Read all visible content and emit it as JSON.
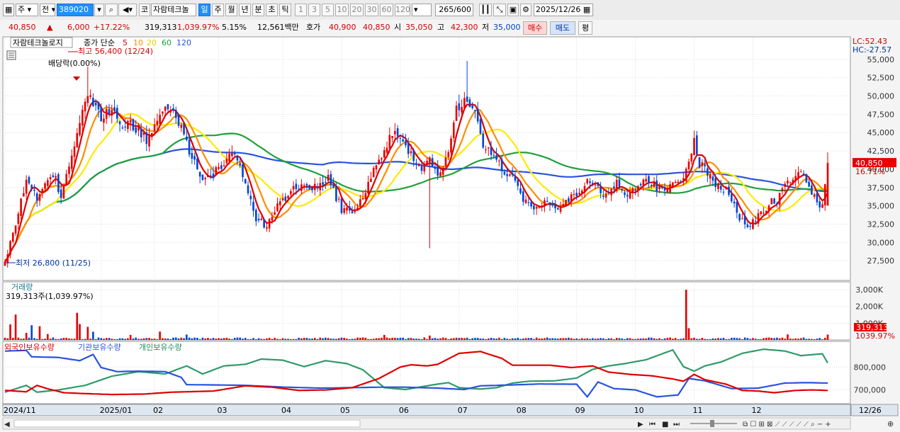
{
  "toolbar": {
    "market": "주",
    "type": "전",
    "code": "389020",
    "stock_type": "코",
    "stock_name": "자람테크놀",
    "periods": [
      "일",
      "주",
      "월",
      "년",
      "분",
      "초",
      "틱"
    ],
    "active_period": "일",
    "ticks": [
      "1",
      "3",
      "5",
      "10",
      "20",
      "30",
      "60",
      "120"
    ],
    "count": "265",
    "count_total": "/600",
    "date": "2025/12/26"
  },
  "quote": {
    "price": "40,850",
    "change": "6,000",
    "change_pct": "+17.22%",
    "volume": "319,313",
    "volume_ratio": "1,039.97%",
    "turnover": "5.15%",
    "amount": "12,561백만",
    "bid_label": "호가",
    "bid": "40,900",
    "ask": "40,850",
    "open_label": "시",
    "open": "35,050",
    "high_label": "고",
    "high": "42,300",
    "low_label": "저",
    "low": "35,000",
    "buy": "매수",
    "sell": "매도",
    "avg": "평"
  },
  "colors": {
    "up": "#e60000",
    "down": "#0046d5",
    "ma5": "#e00000",
    "ma10": "#ff8c00",
    "ma20": "#ffea00",
    "ma60": "#1fa03c",
    "ma120": "#2a52e0"
  },
  "chart_data": [
    {
      "type": "candlestick",
      "legend_stock": "자람테크놀로지",
      "legend_prefix": "종가 단순",
      "ma_periods": [
        "5",
        "10",
        "20",
        "60",
        "120"
      ],
      "y_ticks": [
        "55,000",
        "52,500",
        "50,000",
        "47,500",
        "45,000",
        "42,500",
        "40,000",
        "37,500",
        "35,000",
        "32,500",
        "30,000",
        "27,500"
      ],
      "y_tick_values": [
        55000,
        52500,
        50000,
        47500,
        45000,
        42500,
        40000,
        37500,
        35000,
        32500,
        30000,
        27500
      ],
      "ylim": [
        25000,
        57500
      ],
      "lc": "LC:52.43",
      "hc": "HC:-27.57",
      "last_price": "40,850",
      "last_pct": "16.71%",
      "annotation_high": "최고 56,400 (12/24)",
      "annotation_low": "최저 26,800 (11/25)",
      "annotation_dividend": "배당락(0.00%)",
      "anchors": [
        [
          0,
          27200
        ],
        [
          8,
          38500
        ],
        [
          12,
          35800
        ],
        [
          18,
          39500
        ],
        [
          21,
          36200
        ],
        [
          26,
          43200
        ],
        [
          31,
          50200
        ],
        [
          36,
          46800
        ],
        [
          40,
          48600
        ],
        [
          43,
          45700
        ],
        [
          47,
          46300
        ],
        [
          53,
          44200
        ],
        [
          58,
          47800
        ],
        [
          63,
          48200
        ],
        [
          68,
          43600
        ],
        [
          71,
          40800
        ],
        [
          75,
          38500
        ],
        [
          79,
          39800
        ],
        [
          84,
          41800
        ],
        [
          88,
          40900
        ],
        [
          94,
          33200
        ],
        [
          98,
          32200
        ],
        [
          102,
          34800
        ],
        [
          107,
          37000
        ],
        [
          112,
          37600
        ],
        [
          117,
          37400
        ],
        [
          121,
          38600
        ],
        [
          126,
          34600
        ],
        [
          130,
          33800
        ],
        [
          134,
          36600
        ],
        [
          138,
          39600
        ],
        [
          142,
          42600
        ],
        [
          146,
          45600
        ],
        [
          151,
          42600
        ],
        [
          155,
          40200
        ],
        [
          159,
          40900
        ],
        [
          163,
          39200
        ],
        [
          166,
          42600
        ],
        [
          169,
          48600
        ],
        [
          173,
          49600
        ],
        [
          176,
          48600
        ],
        [
          179,
          43600
        ],
        [
          182,
          41600
        ],
        [
          186,
          40100
        ],
        [
          190,
          38600
        ],
        [
          194,
          36100
        ],
        [
          198,
          34800
        ],
        [
          202,
          35600
        ],
        [
          206,
          34800
        ],
        [
          210,
          35300
        ],
        [
          214,
          36600
        ],
        [
          218,
          38600
        ],
        [
          221,
          38200
        ],
        [
          225,
          36100
        ],
        [
          229,
          38600
        ],
        [
          233,
          36100
        ],
        [
          237,
          37600
        ],
        [
          241,
          38600
        ],
        [
          245,
          37200
        ],
        [
          249,
          37600
        ],
        [
          253,
          37800
        ],
        [
          256,
          40600
        ],
        [
          258,
          44600
        ],
        [
          260,
          40600
        ],
        [
          262,
          40100
        ],
        [
          266,
          38100
        ],
        [
          270,
          37100
        ],
        [
          274,
          34100
        ],
        [
          278,
          32100
        ],
        [
          282,
          33600
        ],
        [
          286,
          35200
        ],
        [
          290,
          36200
        ],
        [
          294,
          38600
        ],
        [
          297,
          40200
        ],
        [
          300,
          38600
        ],
        [
          304,
          35600
        ],
        [
          306,
          35100
        ],
        [
          308,
          40850
        ]
      ],
      "volume_panel": {
        "title": "거래량",
        "subtitle": "319,313주(1,039.97%)",
        "y_ticks": [
          "3,000K",
          "2,000K",
          "1,000K"
        ],
        "y_tick_values": [
          3000000,
          2000000,
          1000000
        ],
        "ylim": [
          0,
          3300000
        ],
        "last": "319,313",
        "last_pct": "1039.97%",
        "spikes": [
          [
            2,
            930000
          ],
          [
            4,
            1520000
          ],
          [
            8,
            420000
          ],
          [
            10,
            880000
          ],
          [
            13,
            820000
          ],
          [
            16,
            350000
          ],
          [
            27,
            1620000
          ],
          [
            28,
            950000
          ],
          [
            31,
            780000
          ],
          [
            33,
            490000
          ],
          [
            47,
            300000
          ],
          [
            58,
            500000
          ],
          [
            68,
            320000
          ],
          [
            142,
            300000
          ],
          [
            159,
            260000
          ],
          [
            255,
            3000000
          ],
          [
            256,
            700000
          ],
          [
            293,
            330000
          ],
          [
            308,
            319313
          ]
        ]
      },
      "holdings_panel": {
        "legend": [
          "외국인보유수량",
          "기관보유수량",
          "개인보유수량"
        ],
        "y_ticks": [
          "800,000",
          "700,000"
        ],
        "y_tick_values": [
          800000,
          700000
        ],
        "ylim": [
          640000,
          900000
        ],
        "foreign": [
          [
            0,
            698000
          ],
          [
            8,
            692000
          ],
          [
            12,
            720000
          ],
          [
            16,
            705000
          ],
          [
            22,
            688000
          ],
          [
            30,
            684000
          ],
          [
            40,
            680000
          ],
          [
            52,
            682000
          ],
          [
            62,
            690000
          ],
          [
            78,
            695000
          ],
          [
            90,
            718000
          ],
          [
            100,
            712000
          ],
          [
            110,
            698000
          ],
          [
            120,
            700000
          ],
          [
            130,
            710000
          ],
          [
            140,
            750000
          ],
          [
            148,
            800000
          ],
          [
            152,
            810000
          ],
          [
            158,
            805000
          ],
          [
            162,
            812000
          ],
          [
            170,
            860000
          ],
          [
            178,
            868000
          ],
          [
            186,
            838000
          ],
          [
            190,
            808000
          ],
          [
            196,
            808000
          ],
          [
            204,
            808000
          ],
          [
            212,
            798000
          ],
          [
            220,
            805000
          ],
          [
            226,
            778000
          ],
          [
            234,
            768000
          ],
          [
            242,
            762000
          ],
          [
            250,
            748000
          ],
          [
            254,
            738000
          ],
          [
            258,
            768000
          ],
          [
            262,
            745000
          ],
          [
            270,
            725000
          ],
          [
            276,
            698000
          ],
          [
            282,
            695000
          ],
          [
            288,
            688000
          ],
          [
            296,
            698000
          ],
          [
            302,
            700000
          ],
          [
            308,
            698000
          ]
        ],
        "institution": [
          [
            0,
            870000
          ],
          [
            8,
            873000
          ],
          [
            10,
            845000
          ],
          [
            20,
            842000
          ],
          [
            28,
            828000
          ],
          [
            33,
            855000
          ],
          [
            36,
            798000
          ],
          [
            42,
            780000
          ],
          [
            50,
            782000
          ],
          [
            60,
            780000
          ],
          [
            66,
            755000
          ],
          [
            68,
            723000
          ],
          [
            78,
            722000
          ],
          [
            90,
            720000
          ],
          [
            105,
            712000
          ],
          [
            118,
            708000
          ],
          [
            130,
            710000
          ],
          [
            140,
            712000
          ],
          [
            150,
            712000
          ],
          [
            162,
            708000
          ],
          [
            172,
            702000
          ],
          [
            178,
            718000
          ],
          [
            190,
            722000
          ],
          [
            200,
            726000
          ],
          [
            214,
            725000
          ],
          [
            218,
            670000
          ],
          [
            222,
            735000
          ],
          [
            228,
            706000
          ],
          [
            236,
            700000
          ],
          [
            244,
            670000
          ],
          [
            252,
            678000
          ],
          [
            256,
            750000
          ],
          [
            262,
            740000
          ],
          [
            272,
            706000
          ],
          [
            282,
            708000
          ],
          [
            292,
            730000
          ],
          [
            300,
            732000
          ],
          [
            308,
            730000
          ]
        ],
        "individual": [
          [
            0,
            690000
          ],
          [
            8,
            720000
          ],
          [
            12,
            690000
          ],
          [
            20,
            700000
          ],
          [
            30,
            720000
          ],
          [
            40,
            760000
          ],
          [
            50,
            780000
          ],
          [
            60,
            770000
          ],
          [
            68,
            805000
          ],
          [
            74,
            770000
          ],
          [
            82,
            805000
          ],
          [
            90,
            812000
          ],
          [
            96,
            835000
          ],
          [
            104,
            830000
          ],
          [
            112,
            802000
          ],
          [
            120,
            828000
          ],
          [
            128,
            815000
          ],
          [
            134,
            788000
          ],
          [
            142,
            710000
          ],
          [
            150,
            702000
          ],
          [
            160,
            722000
          ],
          [
            166,
            732000
          ],
          [
            170,
            710000
          ],
          [
            178,
            704000
          ],
          [
            184,
            710000
          ],
          [
            190,
            730000
          ],
          [
            196,
            738000
          ],
          [
            206,
            740000
          ],
          [
            214,
            752000
          ],
          [
            220,
            790000
          ],
          [
            226,
            805000
          ],
          [
            232,
            815000
          ],
          [
            240,
            832000
          ],
          [
            250,
            875000
          ],
          [
            254,
            802000
          ],
          [
            258,
            782000
          ],
          [
            262,
            805000
          ],
          [
            268,
            822000
          ],
          [
            276,
            860000
          ],
          [
            284,
            878000
          ],
          [
            292,
            870000
          ],
          [
            298,
            850000
          ],
          [
            306,
            858000
          ],
          [
            308,
            818000
          ]
        ]
      },
      "x_ticks": [
        "2024/11",
        "2025/01",
        "02",
        "03",
        "04",
        "05",
        "06",
        "07",
        "08",
        "09",
        "10",
        "11",
        "12"
      ],
      "x_tick_index": [
        0,
        36,
        56,
        80,
        104,
        126,
        148,
        170,
        192,
        214,
        236,
        258,
        280
      ],
      "x_right_label": "12/26",
      "n_days": 309
    }
  ]
}
